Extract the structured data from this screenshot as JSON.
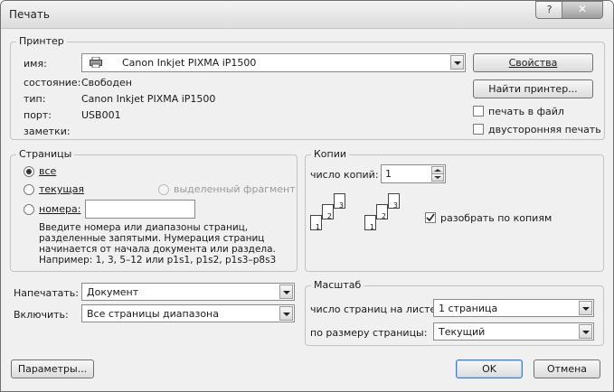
{
  "window": {
    "title": "Печать",
    "help_label": "?",
    "close_label": "✕"
  },
  "printer": {
    "group_label": "Принтер",
    "name_label": "имя:",
    "name_value": "Canon Inkjet PIXMA iP1500",
    "status_label": "состояние:",
    "status_value": "Свободен",
    "type_label": "тип:",
    "type_value": "Canon Inkjet PIXMA iP1500",
    "port_label": "порт:",
    "port_value": "USB001",
    "notes_label": "заметки:",
    "properties_label": "Свойства",
    "find_printer_label": "Найти принтер...",
    "print_to_file_label": "печать в файл",
    "duplex_label": "двусторонняя печать"
  },
  "pages": {
    "group_label": "Страницы",
    "all_label": "все",
    "current_label": "текущая",
    "selection_label": "выделенный фрагмент",
    "numbers_label": "номера:",
    "numbers_value": "",
    "hint_lines": [
      "Введите номера или диапазоны страниц,",
      "разделенные запятыми. Нумерация страниц",
      "начинается от начала документа или раздела.",
      "Например: 1, 3, 5–12 или p1s1, p1s2, p1s3–p8s3"
    ]
  },
  "copies": {
    "group_label": "Копии",
    "count_label": "число копий:",
    "count_value": "1",
    "collate_label": "разобрать по копиям",
    "page_numbers": [
      "1",
      "2",
      "3"
    ]
  },
  "print_what": {
    "label": "Напечатать:",
    "value": "Документ"
  },
  "include": {
    "label": "Включить:",
    "value": "Все страницы диапазона"
  },
  "scale": {
    "group_label": "Масштаб",
    "pages_per_sheet_label": "число страниц на листе:",
    "pages_per_sheet_value": "1 страница",
    "fit_label": "по размеру страницы:",
    "fit_value": "Текущий"
  },
  "footer": {
    "options_label": "Параметры...",
    "ok_label": "OK",
    "cancel_label": "Отмена"
  }
}
